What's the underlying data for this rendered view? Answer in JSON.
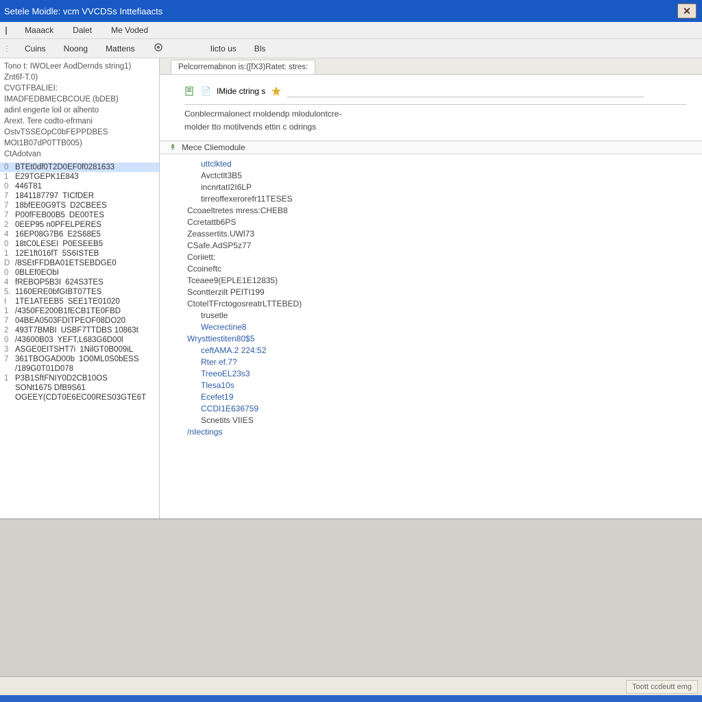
{
  "title": "Setele Moidle: vcm VVCDSs Inttefiaacts",
  "menubar": {
    "items": [
      "Maaack",
      "Dalet",
      "Me Voded"
    ]
  },
  "toolbar": {
    "items": [
      "Cuins",
      "Noong",
      "Mattens",
      "Iicto us",
      "Bls"
    ]
  },
  "left": {
    "header": [
      "Tono t: IWOLeer AodDernds string1)",
      "Znt6f-T.0)",
      "CVGTFBALIEI:",
      "IMADFEDBMECBCOUE (bDEB)",
      "adinl engerte loil or alhento",
      "Arext.   Tere codto-efrmani",
      "OstvTSSEOpC0bFEPPDBES",
      "MOt1B07dP0TTB005)",
      "CtAdotvan"
    ],
    "rows": [
      {
        "i": "0",
        "code": "BTEt0df0T2D0EF0f0281633",
        "desc": "",
        "sel": true
      },
      {
        "i": "1",
        "code": "E29TGEPK1E843",
        "desc": ""
      },
      {
        "i": "0",
        "code": "446T81",
        "desc": ""
      },
      {
        "i": "7",
        "code": "1841187797",
        "desc": "TICfDER"
      },
      {
        "i": "7",
        "code": "18bfEE0G9TS",
        "desc": "D2CBEES"
      },
      {
        "i": "7",
        "code": "P00fFEB00B5",
        "desc": "DE00TES"
      },
      {
        "i": "2",
        "code": "0EEP95  n0PFELPERES",
        "desc": ""
      },
      {
        "i": "4",
        "code": "16EP08G7B6",
        "desc": "E2S68E5"
      },
      {
        "i": "0",
        "code": "18tC0LESEI",
        "desc": "P0ESEEB5"
      },
      {
        "i": "1",
        "code": "12E1ft016fT",
        "desc": "5S6ISTEB"
      },
      {
        "i": "D",
        "code": "/8SEtFFDBA01ETSEBDGE0",
        "desc": ""
      },
      {
        "i": "0",
        "code": "0BLEf0EObI",
        "desc": ""
      },
      {
        "i": "4",
        "code": "fREBOP5B3I",
        "desc": "624S3TES"
      },
      {
        "i": "5.",
        "code": "1160ERE0bfGIBT07TES",
        "desc": ""
      },
      {
        "i": "I",
        "code": "1TE1ATEEB5",
        "desc": "SEE1TE01020"
      },
      {
        "i": "1",
        "code": "/4350FE200B1fECB1TE0FBD",
        "desc": ""
      },
      {
        "i": "7",
        "code": "04BEA0503FDITPEOF08DO20",
        "desc": ""
      },
      {
        "i": "2",
        "code": "493T7BMBI",
        "desc": "USBF7TTDBS  10863t"
      },
      {
        "i": "0",
        "code": "/43600B03",
        "desc": "YEFT,L683G6D00l"
      },
      {
        "i": "3",
        "code": "ASGE0EITSHT7i",
        "desc": "1NilGT0B009iL"
      },
      {
        "i": "7",
        "code": "361TBOGAD00b",
        "desc": "1O0ML0S0bESS"
      },
      {
        "i": "",
        "code": "/189G0T01D078",
        "desc": ""
      },
      {
        "i": "1",
        "code": "P3B1SftFNIY0D2CB10OS",
        "desc": ""
      },
      {
        "i": "",
        "code": "SONt1675   DfB9S61",
        "desc": ""
      },
      {
        "i": "",
        "code": "OGEEY(CDT0E6EC00RES03GTE6T",
        "desc": ""
      }
    ]
  },
  "right": {
    "tab_label": "Pelcorremabnon is:([fX3)Ratet: stres:",
    "mid_label": "IMide ctring s",
    "desc_lines": [
      "Conblecrmalonect rnoldendp mlodulontcre-",
      "molder tto motilvends ettin c odrings"
    ],
    "subheader": "Mece Cliemodule",
    "details": [
      {
        "t": "lnk",
        "ind": 2,
        "text": "uttclkted"
      },
      {
        "t": "lbl",
        "ind": 2,
        "text": "Avctctlt3B5"
      },
      {
        "t": "lbl",
        "ind": 2,
        "text": "incnrtatI2I6LP"
      },
      {
        "t": "lbl",
        "ind": 2,
        "text": "tirreoffexerorefr11TESES"
      },
      {
        "t": "lbl",
        "ind": 1,
        "text": "Ccoaeltretes  mress:CHEB8"
      },
      {
        "t": "lbl",
        "ind": 1,
        "text": "Ccretattb6PS"
      },
      {
        "t": "lbl",
        "ind": 1,
        "text": "Zeassertits.UWl73"
      },
      {
        "t": "lbl",
        "ind": 1,
        "text": "CSafe.AdSP5z77"
      },
      {
        "t": "lbl",
        "ind": 1,
        "text": "Coriiett:"
      },
      {
        "t": "lbl",
        "ind": 1,
        "text": "Ccoineftc"
      },
      {
        "t": "lbl",
        "ind": 1,
        "text": "Tceaee9(EPLE1E12835)"
      },
      {
        "t": "lbl",
        "ind": 1,
        "text": "Scontterzilt  PEITI199"
      },
      {
        "t": "lbl",
        "ind": 1,
        "text": "CtotelTFrctogosreatrLTTEBED)"
      },
      {
        "t": "lbl",
        "ind": 2,
        "text": "trusetle"
      },
      {
        "t": "lnk",
        "ind": 2,
        "text": "Wecrectine8"
      },
      {
        "t": "lnk",
        "ind": 1,
        "text": "Wrysttiestiten80$5"
      },
      {
        "t": "lnk",
        "ind": 2,
        "text": "ceftAMA.2 224:52"
      },
      {
        "t": "lnk",
        "ind": 2,
        "text": "Rter ef.7?"
      },
      {
        "t": "lnk",
        "ind": 2,
        "text": "TreeoEL23s3"
      },
      {
        "t": "lnk",
        "ind": 2,
        "text": "Tlesa10s"
      },
      {
        "t": "lnk",
        "ind": 2,
        "text": "Ecefet19"
      },
      {
        "t": "lnk",
        "ind": 2,
        "text": "CCDI1E636759"
      },
      {
        "t": "lbl",
        "ind": 2,
        "text": "Scnetits   VIIES"
      },
      {
        "t": "lnk",
        "ind": 1,
        "text": "/nIectings"
      }
    ]
  },
  "status": {
    "text": "Toott ccdeutt emg"
  }
}
